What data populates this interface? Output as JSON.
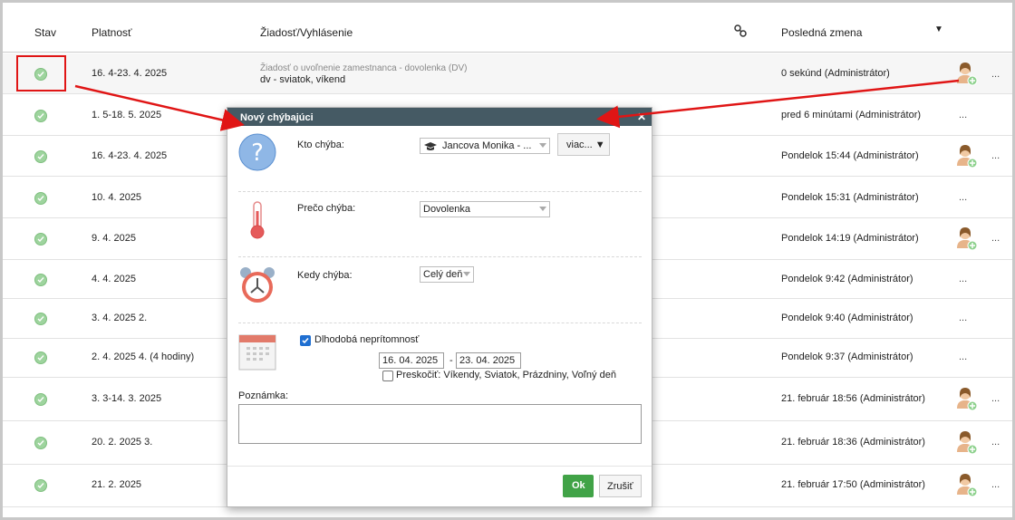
{
  "header": {
    "col_status": "Stav",
    "col_validity": "Platnosť",
    "col_request": "Žiadosť/Vyhlásenie",
    "col_last_change": "Posledná zmena",
    "sort_indicator": "▼"
  },
  "rows": [
    {
      "validity": "16. 4-23. 4. 2025",
      "request_sub": "Žiadosť o uvoľnenie zamestnanca - dovolenka (DV)",
      "request_main": "dv - sviatok, víkend",
      "last_change": "0 sekúnd (Administrátor)"
    },
    {
      "validity": "1. 5-18. 5. 2025",
      "request_sub": "",
      "request_main": "",
      "last_change": "pred 6 minútami (Administrátor)"
    },
    {
      "validity": "16. 4-23. 4. 2025",
      "request_sub": "",
      "request_main": "",
      "last_change": "Pondelok 15:44 (Administrátor)"
    },
    {
      "validity": "10. 4. 2025",
      "request_sub": "",
      "request_main": "",
      "last_change": "Pondelok 15:31 (Administrátor)"
    },
    {
      "validity": "9. 4. 2025",
      "request_sub": "",
      "request_main": "",
      "last_change": "Pondelok 14:19 (Administrátor)"
    },
    {
      "validity": "4. 4. 2025",
      "request_sub": "",
      "request_main": "",
      "last_change": "Pondelok 9:42 (Administrátor)"
    },
    {
      "validity": "3. 4. 2025 2.",
      "request_sub": "",
      "request_main": "",
      "last_change": "Pondelok 9:40 (Administrátor)"
    },
    {
      "validity": "2. 4. 2025 4. (4 hodiny)",
      "request_sub": "",
      "request_main": "",
      "last_change": "Pondelok 9:37 (Administrátor)"
    },
    {
      "validity": "3. 3-14. 3. 2025",
      "request_sub": "",
      "request_main": "",
      "last_change": "21. február 18:56 (Administrátor)"
    },
    {
      "validity": "20. 2. 2025 3.",
      "request_sub": "",
      "request_main": "",
      "last_change": "21. február 18:36 (Administrátor)"
    },
    {
      "validity": "21. 2. 2025",
      "request_sub": "",
      "request_main": "",
      "last_change": "21. február 17:50 (Administrátor)"
    }
  ],
  "row_more": "...",
  "dialog": {
    "title": "Nový chýbajúci",
    "close": "✕",
    "who_label": "Kto chýba:",
    "who_value": "Jancova Monika - ...",
    "more_button": "viac... ▼",
    "why_label": "Prečo chýba:",
    "why_value": "Dovolenka",
    "when_label": "Kedy chýba:",
    "when_value": "Celý deň",
    "long_absence_label": "Dlhodobá neprítomnosť",
    "date_from": "16. 04. 2025",
    "date_sep": "-",
    "date_to": "23. 04. 2025",
    "skip_label": "Preskočiť: Víkendy, Sviatok, Prázdniny, Voľný deň",
    "note_label": "Poznámka:",
    "ok_button": "Ok",
    "cancel_button": "Zrušiť"
  },
  "colors": {
    "title_bar": "#455a64",
    "ok": "#41a347",
    "status_ok": "#9ed49e",
    "annotation": "#e01515"
  }
}
